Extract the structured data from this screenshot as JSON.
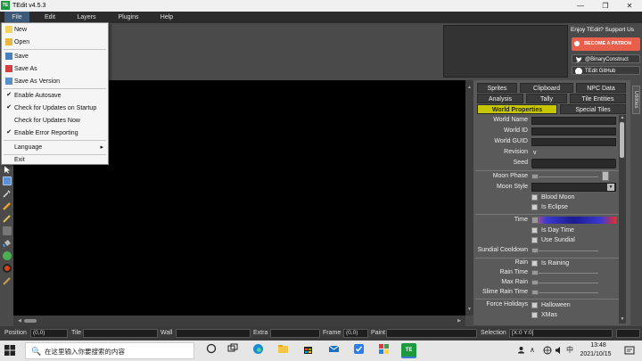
{
  "window": {
    "title": "TEdit v4.5.3",
    "app_icon_text": "TE",
    "minimize": "—",
    "restore": "❐",
    "close": "✕"
  },
  "menubar": {
    "items": [
      "File",
      "Edit",
      "Layers",
      "Plugins",
      "Help"
    ]
  },
  "file_menu": {
    "items": [
      {
        "label": "New",
        "icon": "new-file-icon"
      },
      {
        "label": "Open",
        "icon": "open-folder-icon"
      },
      {
        "label": "Save",
        "icon": "save-icon"
      },
      {
        "label": "Save As",
        "icon": "save-as-icon"
      },
      {
        "label": "Save As Version",
        "icon": "save-version-icon"
      },
      {
        "label": "Enable Autosave",
        "checked": true
      },
      {
        "label": "Check for Updates on Startup",
        "checked": true
      },
      {
        "label": "Check for Updates Now",
        "checked": false
      },
      {
        "label": "Enable Error Reporting",
        "checked": true
      },
      {
        "label": "Language",
        "submenu_arrow": "▸"
      },
      {
        "label": "Exit"
      }
    ],
    "checkmark": "✔"
  },
  "support": {
    "text": "Enjoy TEdit? Support Us",
    "patron_label": "BECOME A PATRON",
    "twitter_label": "@BinaryConstruct",
    "github_label": "TEdit GitHub"
  },
  "panel": {
    "tabs_row1": [
      "Sprites",
      "Clipboard",
      "NPC Data"
    ],
    "tabs_row2": [
      "Analysis",
      "Tally",
      "Tile Entities"
    ],
    "tabs_row3": [
      "World Properties",
      "Special Tiles"
    ],
    "active_tab": "World Properties",
    "side_tab": "Utilities"
  },
  "world_properties": {
    "world_name": "World Name",
    "world_id": "World ID",
    "world_guid": "World GUID",
    "revision": "Revision",
    "revision_value": "v",
    "seed": "Seed",
    "moon_phase": "Moon Phase",
    "moon_style": "Moon Style",
    "blood_moon": "Blood Moon",
    "is_eclipse": "Is Eclipse",
    "time": "Time",
    "is_day_time": "Is Day Time",
    "use_sundial": "Use Sundial",
    "sundial_cooldown": "Sundial Cooldown",
    "rain": "Rain",
    "is_raining": "Is Raining",
    "rain_time": "Rain Time",
    "max_rain": "Max Rain",
    "slime_rain_time": "Slime Rain Time",
    "force_holidays": "Force Holidays",
    "halloween": "Halloween",
    "xmas": "XMas"
  },
  "statusbar": {
    "position_label": "Position",
    "position_value": "(0,0)",
    "tile_label": "Tile",
    "wall_label": "Wall",
    "extra_label": "Extra",
    "frame_label": "Frame",
    "frame_value": "(0,0)",
    "paint_label": "Paint",
    "selection_label": "Selection",
    "selection_value": "[X:0 Y:0]"
  },
  "taskbar": {
    "search_placeholder": "在这里输入你要搜索的内容",
    "search_icon": "🔍",
    "tray_chevron": "∧",
    "input_method": "中",
    "time": "13:48",
    "date": "2021/10/15"
  },
  "colors": {
    "accent_yellow": "#c8c800",
    "patron_orange": "#e8604c",
    "tedit_green": "#1b9b3e"
  }
}
